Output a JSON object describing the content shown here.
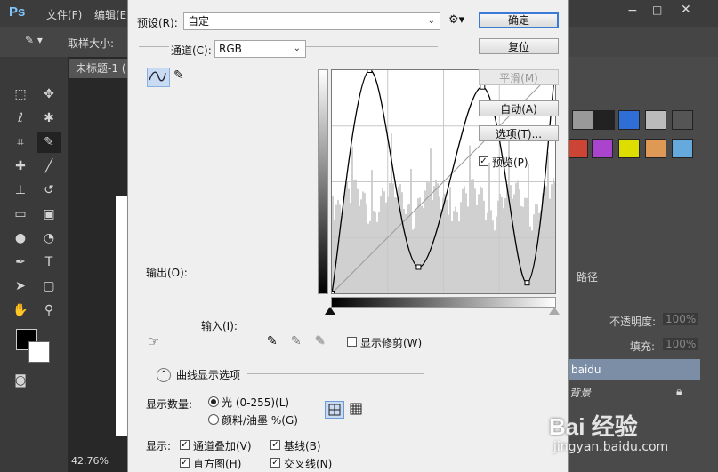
{
  "app": {
    "menu": [
      "文件(F)",
      "编辑(E)"
    ],
    "options_bar": {
      "sample_size_label": "取样大小:"
    },
    "document": {
      "tab_title": "未标题-1 (",
      "zoom": "42.76%"
    },
    "layers_panel": {
      "tab_label": "路径",
      "opacity_label": "不透明度:",
      "opacity_value": "100%",
      "fill_label": "填充:",
      "fill_value": "100%",
      "layer_name": "baidu",
      "background_layer": "背景"
    }
  },
  "dialog": {
    "preset_label": "预设(R):",
    "preset_value": "自定",
    "channel_label": "通道(C):",
    "channel_value": "RGB",
    "output_label": "输出(O):",
    "input_label": "输入(I):",
    "show_clipping_label": "显示修剪(W)",
    "curve_options_label": "曲线显示选项",
    "show_amount_label": "显示数量:",
    "light_label": "光 (0-255)(L)",
    "pigment_label": "颜料/油墨 %(G)",
    "show_label": "显示:",
    "channel_overlay_label": "通道叠加(V)",
    "baseline_label": "基线(B)",
    "histogram_label": "直方图(H)",
    "intersection_label": "交叉线(N)",
    "buttons": {
      "ok": "确定",
      "reset": "复位",
      "smooth": "平滑(M)",
      "auto": "自动(A)",
      "options": "选项(T)..."
    },
    "preview_label": "预览(P)",
    "preview_checked": true,
    "show_clipping_checked": false,
    "show_amount_mode": "light",
    "grid_mode": "4x4",
    "display": {
      "channel_overlay": true,
      "baseline": true,
      "histogram": true,
      "intersection": true
    },
    "curve_points": [
      [
        0,
        0
      ],
      [
        43,
        255
      ],
      [
        99,
        30
      ],
      [
        172,
        236
      ],
      [
        223,
        12
      ],
      [
        255,
        255
      ]
    ]
  },
  "watermark": {
    "text": "Bai 经验",
    "url": "jingyan.baidu.com"
  },
  "colors": {
    "accent": "#3a7bd5",
    "layer_selected": "#7c8da6"
  }
}
